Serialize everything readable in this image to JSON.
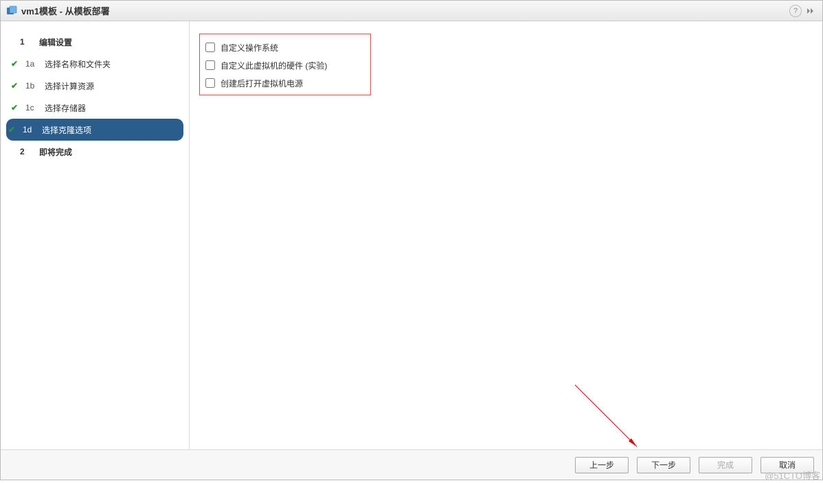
{
  "titlebar": {
    "title": "vm1模板 - 从模板部署",
    "help": "?"
  },
  "sidebar": {
    "steps": [
      {
        "kind": "heading",
        "num": "1",
        "label": "编辑设置",
        "done": false
      },
      {
        "kind": "sub",
        "num": "1a",
        "label": "选择名称和文件夹",
        "done": true
      },
      {
        "kind": "sub",
        "num": "1b",
        "label": "选择计算资源",
        "done": true
      },
      {
        "kind": "sub",
        "num": "1c",
        "label": "选择存储器",
        "done": true
      },
      {
        "kind": "sub",
        "num": "1d",
        "label": "选择克隆选项",
        "done": true,
        "active": true
      },
      {
        "kind": "heading",
        "num": "2",
        "label": "即将完成",
        "done": false
      }
    ]
  },
  "content": {
    "options": [
      {
        "label": "自定义操作系统",
        "checked": false
      },
      {
        "label": "自定义此虚拟机的硬件 (实验)",
        "checked": false
      },
      {
        "label": "创建后打开虚拟机电源",
        "checked": false
      }
    ]
  },
  "footer": {
    "back": "上一步",
    "next": "下一步",
    "finish": "完成",
    "cancel": "取消"
  },
  "watermark": "@51CTO博客"
}
